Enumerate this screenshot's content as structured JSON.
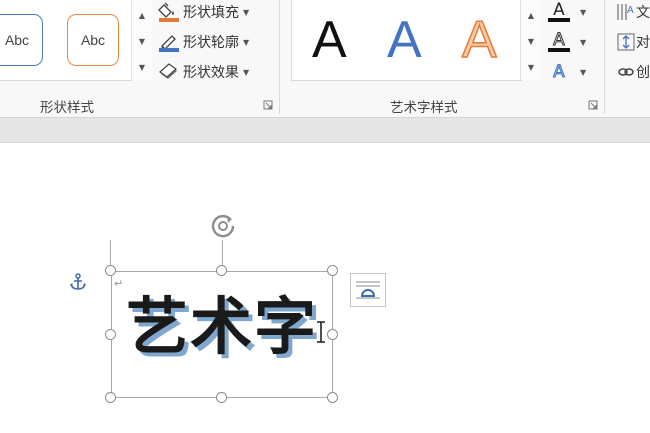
{
  "ribbon": {
    "shape_styles": {
      "group_label": "形状样式",
      "thumbnails": [
        {
          "label": "Abc",
          "border_color": "#4a7ebb"
        },
        {
          "label": "Abc",
          "border_color": "#e08a4a"
        }
      ],
      "commands": [
        {
          "label": "形状填充",
          "icon": "paint-bucket-icon",
          "accent": "#e07b39"
        },
        {
          "label": "形状轮廓",
          "icon": "pen-outline-icon",
          "accent": "#4472c4"
        },
        {
          "label": "形状效果",
          "icon": "shape-effects-icon",
          "accent": "#999999"
        }
      ]
    },
    "wordart_styles": {
      "group_label": "艺术字样式",
      "samples": [
        {
          "label": "A",
          "fill": "#111111",
          "outline": "#111111"
        },
        {
          "label": "A",
          "fill": "#4472c4",
          "outline": "#4472c4"
        },
        {
          "label": "A",
          "fill": "#f4b183",
          "outline": "#e07b39"
        }
      ],
      "commands": [
        {
          "label": "A",
          "icon": "text-fill-icon",
          "bar": "#111111"
        },
        {
          "label": "A",
          "icon": "text-outline-icon",
          "bar": "#111111"
        },
        {
          "label": "A",
          "icon": "text-effects-icon",
          "color": "#4472c4"
        }
      ]
    },
    "text_group": {
      "commands": [
        {
          "label": "文",
          "icon": "text-direction-icon"
        },
        {
          "label": "对",
          "icon": "align-text-icon"
        },
        {
          "label": "创",
          "icon": "link-icon"
        }
      ]
    }
  },
  "document": {
    "wordart_text": "艺术字",
    "accent_shadow": "#7fa7cf"
  }
}
